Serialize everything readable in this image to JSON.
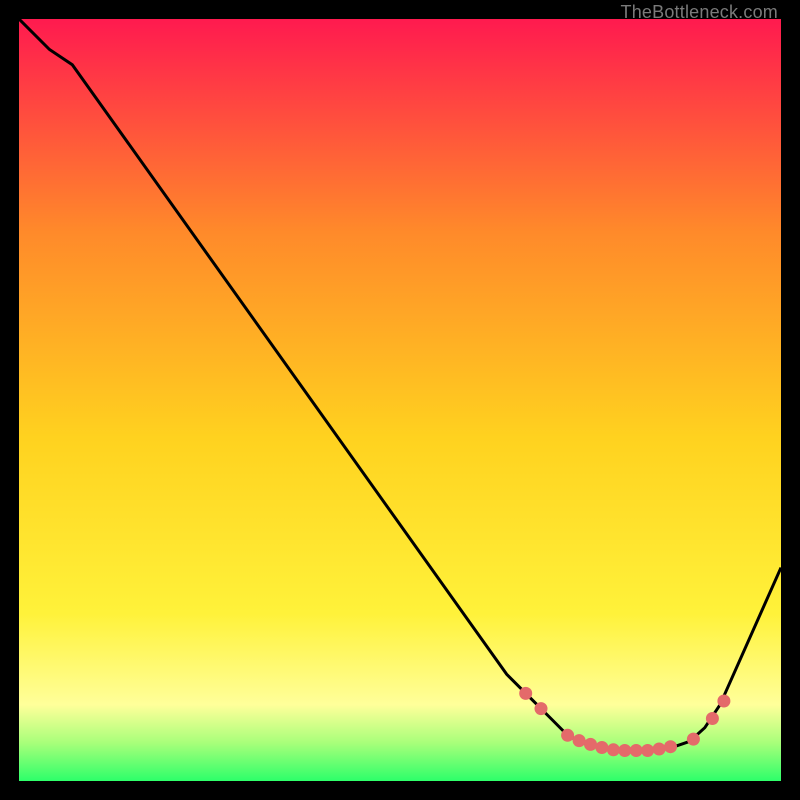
{
  "attribution": "TheBottleneck.com",
  "colors": {
    "background": "#000000",
    "gradient_top": "#ff1a4f",
    "gradient_mid_upper": "#ff8a2a",
    "gradient_mid": "#ffd21f",
    "gradient_mid_lower": "#fff23a",
    "gradient_yellow_pale": "#ffff9a",
    "gradient_green_pale": "#a8ff7a",
    "gradient_green": "#2dff6a",
    "curve": "#000000",
    "dot": "#e46a6a"
  },
  "chart_data": {
    "type": "line",
    "title": "",
    "xlabel": "",
    "ylabel": "",
    "xlim": [
      0,
      100
    ],
    "ylim": [
      0,
      100
    ],
    "series": [
      {
        "name": "bottleneck-curve",
        "x": [
          0,
          4,
          7,
          64,
          68,
          70,
          72,
          74,
          76,
          78,
          80,
          82,
          84,
          86,
          88,
          90,
          92,
          100
        ],
        "y": [
          100,
          96,
          94,
          14,
          10,
          8,
          6,
          5,
          4.5,
          4.2,
          4.0,
          4.0,
          4.2,
          4.5,
          5.2,
          7,
          10,
          28
        ]
      }
    ],
    "markers": {
      "name": "highlight-dots",
      "x": [
        66.5,
        68.5,
        72,
        73.5,
        75,
        76.5,
        78,
        79.5,
        81,
        82.5,
        84,
        85.5,
        88.5,
        91,
        92.5
      ],
      "y": [
        11.5,
        9.5,
        6.0,
        5.3,
        4.8,
        4.4,
        4.1,
        4.0,
        4.0,
        4.0,
        4.2,
        4.5,
        5.5,
        8.2,
        10.5
      ]
    }
  }
}
